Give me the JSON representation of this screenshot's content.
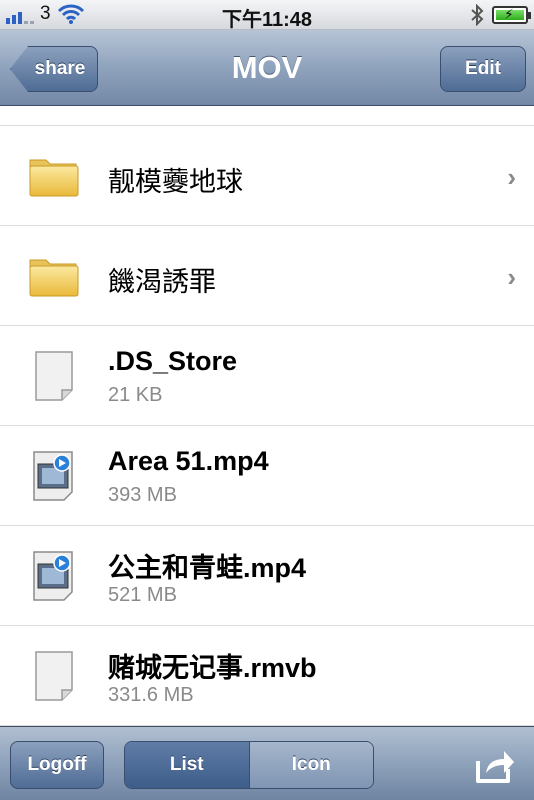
{
  "status_bar": {
    "carrier": "3",
    "time": "下午11:48",
    "icons": [
      "signal-bars-icon",
      "wifi-icon",
      "bluetooth-icon",
      "battery-charging-icon"
    ]
  },
  "nav": {
    "back_label": "share",
    "title": "MOV",
    "edit_label": "Edit"
  },
  "items": [
    {
      "type": "folder",
      "name": "靓模虁地球",
      "icon": "folder-icon"
    },
    {
      "type": "folder",
      "name": "饑渴誘罪",
      "icon": "folder-icon"
    },
    {
      "type": "file",
      "name": ".DS_Store",
      "size": "21 KB",
      "icon": "document-icon"
    },
    {
      "type": "video",
      "name": "Area 51.mp4",
      "size": "393 MB",
      "icon": "video-file-icon"
    },
    {
      "type": "video",
      "name": "公主和青蛙.mp4",
      "size": "521 MB",
      "icon": "video-file-icon"
    },
    {
      "type": "file",
      "name": "赌城无记事.rmvb",
      "size": "331.6 MB",
      "icon": "document-icon"
    }
  ],
  "toolbar": {
    "logoff_label": "Logoff",
    "list_label": "List",
    "icon_label": "Icon",
    "selected_view": "List",
    "share_icon": "share-arrow-icon"
  },
  "colors": {
    "nav_bar": "#8fa3bd",
    "button": "#4f6c95",
    "detail_text": "#8a8a8a"
  }
}
